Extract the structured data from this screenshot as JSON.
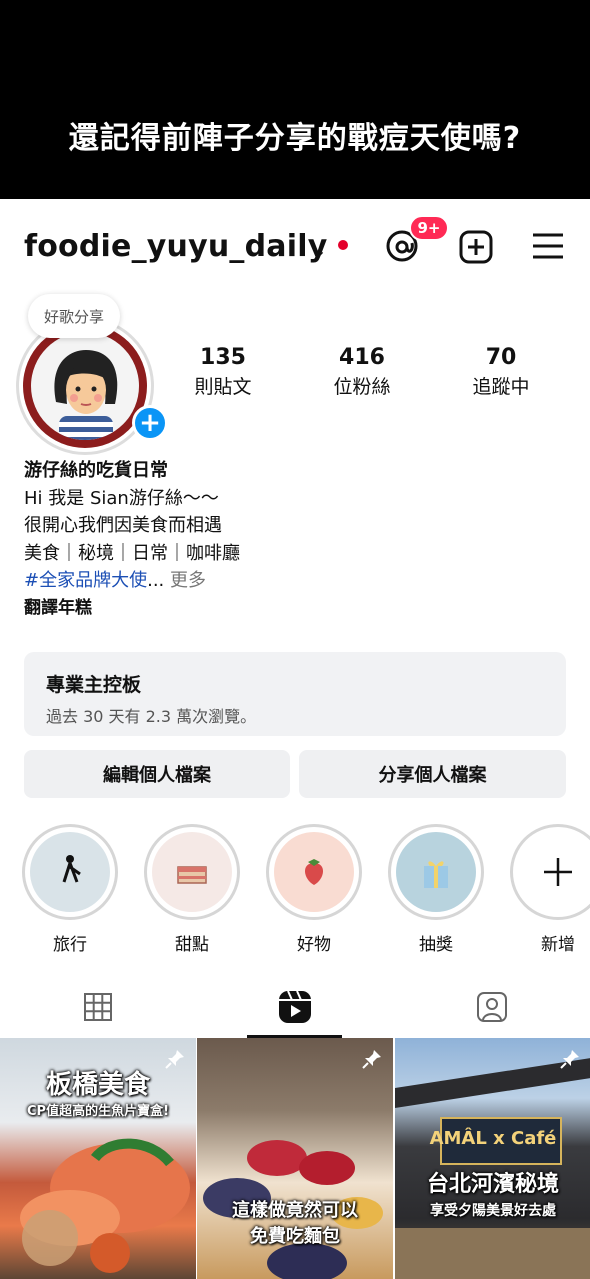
{
  "banner": {
    "caption": "還記得前陣子分享的戰痘天使嗎?"
  },
  "header": {
    "username": "foodie_yuyu_daily",
    "threads_badge": "9+"
  },
  "profile": {
    "note": "好歌分享",
    "stats": [
      {
        "value": "135",
        "label": "則貼文"
      },
      {
        "value": "416",
        "label": "位粉絲"
      },
      {
        "value": "70",
        "label": "追蹤中"
      }
    ],
    "bio": {
      "name": "游仔絲的吃貨日常",
      "lines": [
        "Hi 我是 Sian游仔絲～～",
        "很開心我們因美食而相遇",
        "美食｜秘境｜日常｜咖啡廳"
      ],
      "hashtag": "#全家品牌大使",
      "ellipsis": "...",
      "more": " 更多",
      "translate": "翻譯年糕"
    }
  },
  "dashboard": {
    "title": "專業主控板",
    "subtitle": "過去 30 天有 2.3 萬次瀏覽。"
  },
  "buttons": {
    "edit": "編輯個人檔案",
    "share": "分享個人檔案"
  },
  "highlights": [
    {
      "label": "旅行",
      "bg": "#d9e3e8"
    },
    {
      "label": "甜點",
      "bg": "#f5e9e6"
    },
    {
      "label": "好物",
      "bg": "#f9dcd2"
    },
    {
      "label": "抽獎",
      "bg": "#b8d3de"
    },
    {
      "label": "新增",
      "bg": "#ffffff"
    }
  ],
  "tabs": [
    "grid-icon",
    "reels-icon",
    "tagged-icon"
  ],
  "posts": [
    {
      "title": "板橋美食",
      "subtitle": "CP值超高的生魚片寶盒!"
    },
    {
      "title": "這樣做竟然可以",
      "subtitle": "免費吃麵包"
    },
    {
      "title": "台北河濱秘境",
      "subtitle": "享受夕陽美景好去處",
      "sign": "AMÂL x Café"
    }
  ]
}
